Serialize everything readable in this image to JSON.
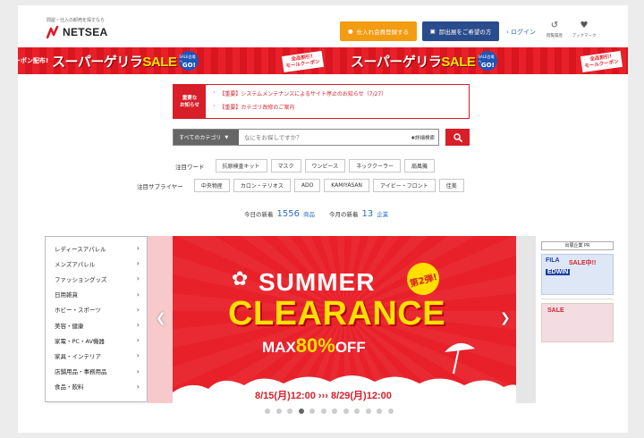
{
  "header": {
    "tagline": "問屋・仕入の卸売を探すなら",
    "logo_text": "NETSEA",
    "register_button": "仕入れ会員登録する",
    "seller_button": "卸出展をご希望の方",
    "login_link": "› ログイン",
    "history_label": "閲覧履歴",
    "bookmark_label": "ブックマーク"
  },
  "sale_banner": {
    "title_prefix": "スーパーゲリラ",
    "title_sale": "SALE",
    "badge_top": "SALE会場へ",
    "badge_go": "GO!",
    "coupon_text_1": "全品割引!",
    "coupon_text_2": "モールクーポン",
    "left_fragment": "ーポン配布!"
  },
  "notice": {
    "tag": "重要な\nお知らせ",
    "items": [
      "【重要】システムメンテナンスによるサイト停止のお知らせ（7/27）",
      "【重要】カテゴリ改修のご案内"
    ]
  },
  "search": {
    "category": "すべてのカテゴリ",
    "placeholder": "なにをお探しですか？",
    "advanced": "✚詳細検索"
  },
  "keywords": {
    "label": "注目ワード",
    "items": [
      "抗原検査キット",
      "マスク",
      "ワンピース",
      "ネッククーラー",
      "扇風機"
    ]
  },
  "suppliers": {
    "label": "注目サプライヤー",
    "items": [
      "中央物産",
      "カロン・テリオス",
      "ADO",
      "KAMIYASAN",
      "アイビー・フロント",
      "佳美"
    ]
  },
  "new_counts": {
    "today_label": "今日の新着",
    "products_count": "1556",
    "products_unit": "商品",
    "month_label": "今月の新着",
    "companies_count": "13",
    "companies_unit": "企業"
  },
  "categories": [
    "レディースアパレル",
    "メンズアパレル",
    "ファッショングッズ",
    "日用雑貨",
    "ホビー・スポーツ",
    "美容・健康",
    "家電・PC・AV機器",
    "家具・インテリア",
    "店舗用品・事務用品",
    "食品・飲料"
  ],
  "hero": {
    "summer": "SUMMER",
    "clearance": "CLEARANCE",
    "max_prefix": "MAX",
    "max_value": "80%",
    "max_suffix": "OFF",
    "badge": "第2弾!",
    "dates": "8/15(月)12:00 ››› 8/29(月)12:00"
  },
  "pr": {
    "title": "出展企業 PR",
    "ad1_brand1": "FILA",
    "ad1_brand2": "EDWIN",
    "ad1_sale": "SALE中!!",
    "ad2_text": "SALE"
  },
  "carousel": {
    "dot_count": 12,
    "active_index": 3
  },
  "colors": {
    "brand_red": "#d81e28",
    "orange_button": "#f39c12",
    "navy_button": "#2b4c8c",
    "link_blue": "#2b6cc4"
  }
}
